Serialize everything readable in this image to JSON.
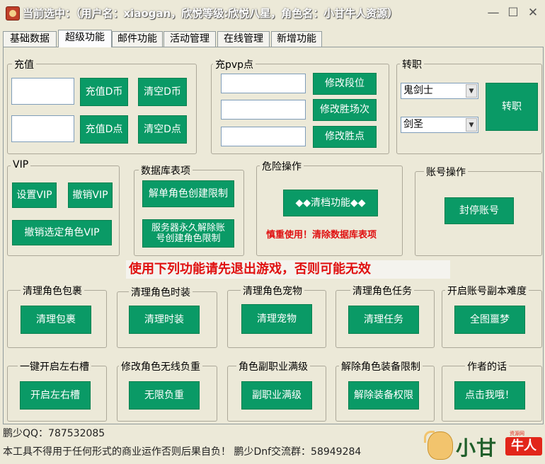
{
  "window": {
    "title": "当前选中：（用户名：xiaogan，欣悦等级:欣悦八星，角色名：小甘牛人资源）",
    "minimize": "—",
    "maximize": "☐",
    "close": "✕"
  },
  "tabs": [
    {
      "label": "基础数据",
      "active": false
    },
    {
      "label": "超级功能",
      "active": true
    },
    {
      "label": "邮件功能",
      "active": false
    },
    {
      "label": "活动管理",
      "active": false
    },
    {
      "label": "在线管理",
      "active": false
    },
    {
      "label": "新增功能",
      "active": false
    }
  ],
  "recharge": {
    "label": "充值",
    "d_coin_button": "充值D币",
    "clear_d_coin_button": "清空D币",
    "d_point_button": "充值D点",
    "clear_d_point_button": "清空D点"
  },
  "pvp": {
    "label": "充pvp点",
    "rank_button": "修改段位",
    "wins_button": "修改胜场次",
    "win_points_button": "修改胜点"
  },
  "job": {
    "label": "转职",
    "class_value": "鬼剑士",
    "subclass_value": "剑圣",
    "button": "转职"
  },
  "vip": {
    "label": "VIP",
    "set_button": "设置VIP",
    "revoke_button": "撤销VIP",
    "revoke_selected_button": "撤销选定角色VIP"
  },
  "database": {
    "label": "数据库表项",
    "unlock_single_button": "解单角色创建限制",
    "unlock_server_button": "服务器永久解除账号创建角色限制"
  },
  "danger": {
    "label": "危险操作",
    "clear_button": "◆◆清档功能◆◆",
    "warning": "慎重使用！清除数据库表项"
  },
  "account": {
    "label": "账号操作",
    "ban_button": "封停账号"
  },
  "notice": "使用下列功能请先退出游戏，否则可能无效",
  "row1": [
    {
      "label": "清理角色包裹",
      "button": "清理包裹"
    },
    {
      "label": "清理角色时装",
      "button": "清理时装"
    },
    {
      "label": "清理角色宠物",
      "button": "清理宠物"
    },
    {
      "label": "清理角色任务",
      "button": "清理任务"
    },
    {
      "label": "开启账号副本难度",
      "button": "全图噩梦"
    }
  ],
  "row2": [
    {
      "label": "一键开启左右槽",
      "button": "开启左右槽"
    },
    {
      "label": "修改角色无线负重",
      "button": "无限负重"
    },
    {
      "label": "角色副职业满级",
      "button": "副职业满级"
    },
    {
      "label": "解除角色装备限制",
      "button": "解除装备权限"
    },
    {
      "label": "作者的话",
      "button": "点击我哦！"
    }
  ],
  "footer": {
    "qq": "鹏少QQ：787532085",
    "disclaimer": "本工具不得用于任何形式的商业运作否则后果自负！  鹏少Dnf交流群：58949284"
  },
  "logo": {
    "text_big": "小甘",
    "text_red": "牛人",
    "text_tiny": "资源网"
  },
  "colors": {
    "button_green": "#0a9a66",
    "warning_red": "#e01010",
    "window_bg": "#ece9d8"
  }
}
